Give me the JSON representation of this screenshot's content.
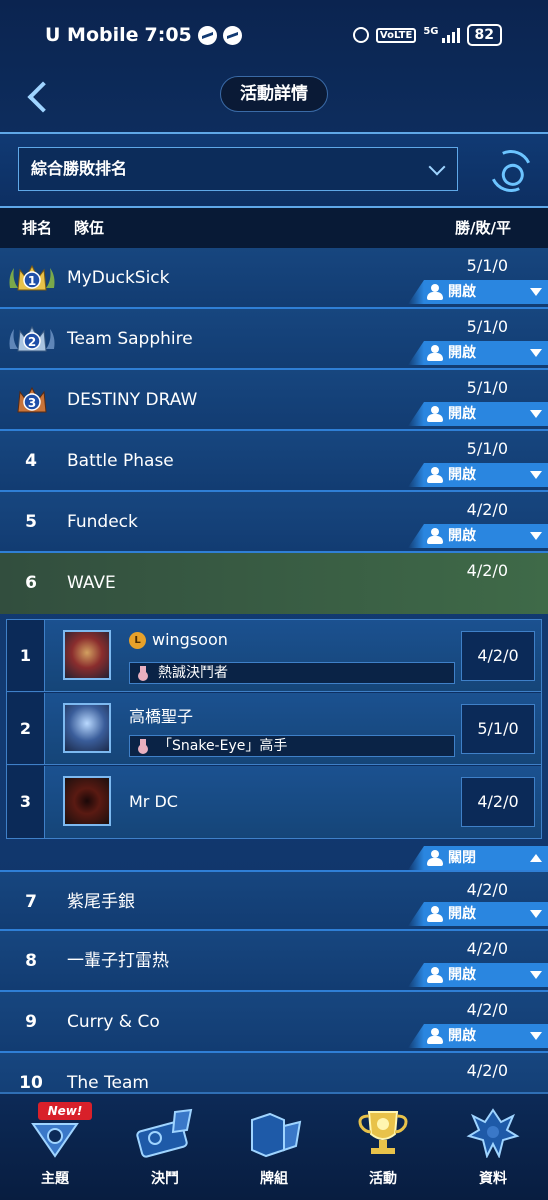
{
  "status_bar": {
    "carrier": "U Mobile",
    "time": "7:05",
    "volte": "VoLTE",
    "network": "5G",
    "battery": "82"
  },
  "header": {
    "title": "活動詳情"
  },
  "filter": {
    "selected": "綜合勝敗排名"
  },
  "columns": {
    "rank": "排名",
    "team": "隊伍",
    "record": "勝/敗/平"
  },
  "teams": [
    {
      "rank": "1",
      "name": "MyDuckSick",
      "record": "5/1/0",
      "toggle": "開啟",
      "crown": "gold"
    },
    {
      "rank": "2",
      "name": "Team Sapphire",
      "record": "5/1/0",
      "toggle": "開啟",
      "crown": "silver"
    },
    {
      "rank": "3",
      "name": "DESTINY DRAW",
      "record": "5/1/0",
      "toggle": "開啟",
      "crown": "bronze"
    },
    {
      "rank": "4",
      "name": "Battle Phase",
      "record": "5/1/0",
      "toggle": "開啟"
    },
    {
      "rank": "5",
      "name": "Fundeck",
      "record": "4/2/0",
      "toggle": "開啟"
    },
    {
      "rank": "6",
      "name": "WAVE",
      "record": "4/2/0",
      "expanded": true
    },
    {
      "rank": "7",
      "name": "紫尾手銀",
      "record": "4/2/0",
      "toggle": "開啟"
    },
    {
      "rank": "8",
      "name": "一輩子打雷热",
      "record": "4/2/0",
      "toggle": "開啟"
    },
    {
      "rank": "9",
      "name": "Curry & Co",
      "record": "4/2/0",
      "toggle": "開啟"
    },
    {
      "rank": "10",
      "name": "The Team",
      "record": "4/2/0"
    }
  ],
  "expanded_team": {
    "members": [
      {
        "rank": "1",
        "name": "wingsoon",
        "level_badge": "L",
        "title": "熱誠決鬥者",
        "record": "4/2/0"
      },
      {
        "rank": "2",
        "name": "高橋聖子",
        "title": "「Snake-Eye」高手",
        "record": "5/1/0"
      },
      {
        "rank": "3",
        "name": "Mr DC",
        "record": "4/2/0"
      }
    ],
    "close_label": "關閉"
  },
  "bottom_nav": {
    "new_badge": "New!",
    "items": [
      {
        "label": "主題",
        "icon": "theme-icon"
      },
      {
        "label": "決鬥",
        "icon": "duel-icon"
      },
      {
        "label": "牌組",
        "icon": "deck-icon"
      },
      {
        "label": "活動",
        "icon": "event-trophy-icon"
      },
      {
        "label": "資料",
        "icon": "data-icon"
      }
    ]
  },
  "colors": {
    "accent": "#2a86e0",
    "highlight_row": "#3f6a48",
    "crown_gold": "#e8c24a",
    "crown_silver": "#aac4e0",
    "crown_bronze": "#c8743a"
  }
}
